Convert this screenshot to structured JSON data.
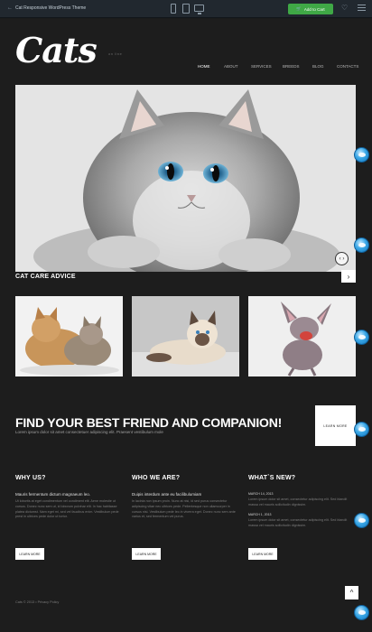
{
  "preview_bar": {
    "title": "Cat Responsive WordPress Theme",
    "cart_label": "Add to Cart",
    "icons": [
      "back-arrow-icon",
      "phone-icon",
      "tablet-icon",
      "desktop-icon",
      "cart-icon",
      "heart-icon",
      "menu-icon"
    ],
    "cart_color": "#3fa846"
  },
  "header": {
    "logo": "Cats",
    "tagline": "on line",
    "nav": [
      "HOME",
      "ABOUT",
      "SERVICES",
      "BREEDS",
      "BLOG",
      "CONTACTS"
    ],
    "active_nav": "HOME"
  },
  "hero": {
    "control": "‹ ›"
  },
  "advice": {
    "title": "CAT CARE ADVICE",
    "next": "›"
  },
  "promo": {
    "title": "FIND YOUR BEST FRIEND AND COMPANION!",
    "subtitle": "Lorem ipsum dolor sit amet consectetuer adipiscing elit. Praesent vestibulum mole",
    "button": "LEARN MORE"
  },
  "columns": {
    "why": {
      "title": "WHY US?",
      "lead": "Mauris fermentum dictum magnaeum leo.",
      "body": "Ut lobortis at eget condimentum vel condiment elit. Aene molestie ut cursus. Donec nunc sem ut, id loborum pulvinar elit. In hac habitasse platea dictumst. Nam eget mi, sed vel faucibus enim. Vestibulum pede prest in ultrices pede dolor ut tortor.",
      "button": "LEARN MORE"
    },
    "who": {
      "title": "WHO WE ARE?",
      "lead": "Duipis interdum ante eu facilibulumiam",
      "body": "In lacinia non ipsum proin. Nunc at nisi, id sed purus consectetur adipiscing vitae nec ultrices pede. Pellentesque non ullamcorper in cursus nisi. Vestibulum pede leo in viverra eget. Donec nunc sem ante varius et, sed fermentum vel purus.",
      "button": "LEARN MORE"
    },
    "news": {
      "title": "WHAT`S NEW?",
      "items": [
        {
          "date": "MARCH 14, 2013",
          "text": "Lorem ipsum dolor sit amet, consectetur adipiscing elit. Sed blandit massa vel mauris sollicitudin dignissim."
        },
        {
          "date": "MARCH 1, 2013",
          "text": "Lorem ipsum dolor sit amet, consectetur adipiscing elit. Sed blandit massa vel mauris sollicitudin dignissim."
        }
      ],
      "button": "LEARN MORE"
    }
  },
  "footer": {
    "text": "Cats © 2013 • Privacy Policy",
    "to_top": "^"
  }
}
